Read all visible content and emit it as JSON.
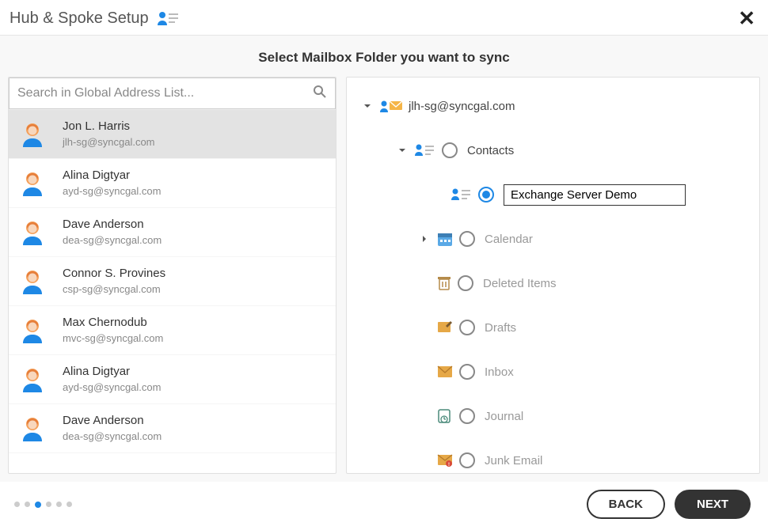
{
  "header": {
    "title": "Hub & Spoke Setup"
  },
  "subtitle": "Select Mailbox Folder you want to sync",
  "search": {
    "placeholder": "Search in Global Address List..."
  },
  "contacts": [
    {
      "name": "Jon L. Harris",
      "email": "jlh-sg@syncgal.com",
      "selected": true
    },
    {
      "name": "Alina Digtyar",
      "email": "ayd-sg@syncgal.com",
      "selected": false
    },
    {
      "name": "Dave Anderson",
      "email": "dea-sg@syncgal.com",
      "selected": false
    },
    {
      "name": "Connor S. Provines",
      "email": "csp-sg@syncgal.com",
      "selected": false
    },
    {
      "name": "Max Chernodub",
      "email": "mvc-sg@syncgal.com",
      "selected": false
    },
    {
      "name": "Alina Digtyar",
      "email": "ayd-sg@syncgal.com",
      "selected": false
    },
    {
      "name": "Dave Anderson",
      "email": "dea-sg@syncgal.com",
      "selected": false
    }
  ],
  "tree": {
    "root_label": "jlh-sg@syncgal.com",
    "contacts_label": "Contacts",
    "selected_value": "Exchange Server Demo",
    "folders": [
      {
        "label": "Calendar"
      },
      {
        "label": "Deleted Items"
      },
      {
        "label": "Drafts"
      },
      {
        "label": "Inbox"
      },
      {
        "label": "Journal"
      },
      {
        "label": "Junk Email"
      }
    ]
  },
  "footer": {
    "back_label": "BACK",
    "next_label": "NEXT",
    "active_step": 3,
    "total_steps": 6
  }
}
